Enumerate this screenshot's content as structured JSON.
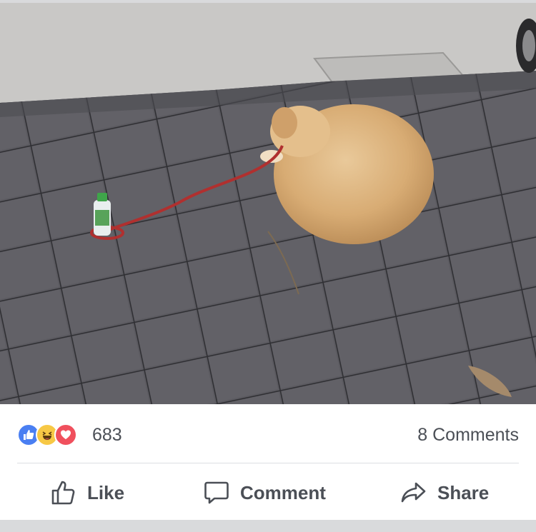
{
  "post": {
    "image_alt": "Golden retriever lying on paving stones with its red leash tied around a water bottle",
    "reactions": [
      "like-reaction-icon",
      "haha-reaction-icon",
      "love-reaction-icon"
    ],
    "reaction_count": "683",
    "comments_label": "8 Comments"
  },
  "actions": {
    "like_label": "Like",
    "comment_label": "Comment",
    "share_label": "Share"
  },
  "colors": {
    "like_blue": "#4a7ff2",
    "haha_yellow": "#f7c845",
    "love_red": "#f0505d",
    "text_gray": "#4b4f56"
  }
}
